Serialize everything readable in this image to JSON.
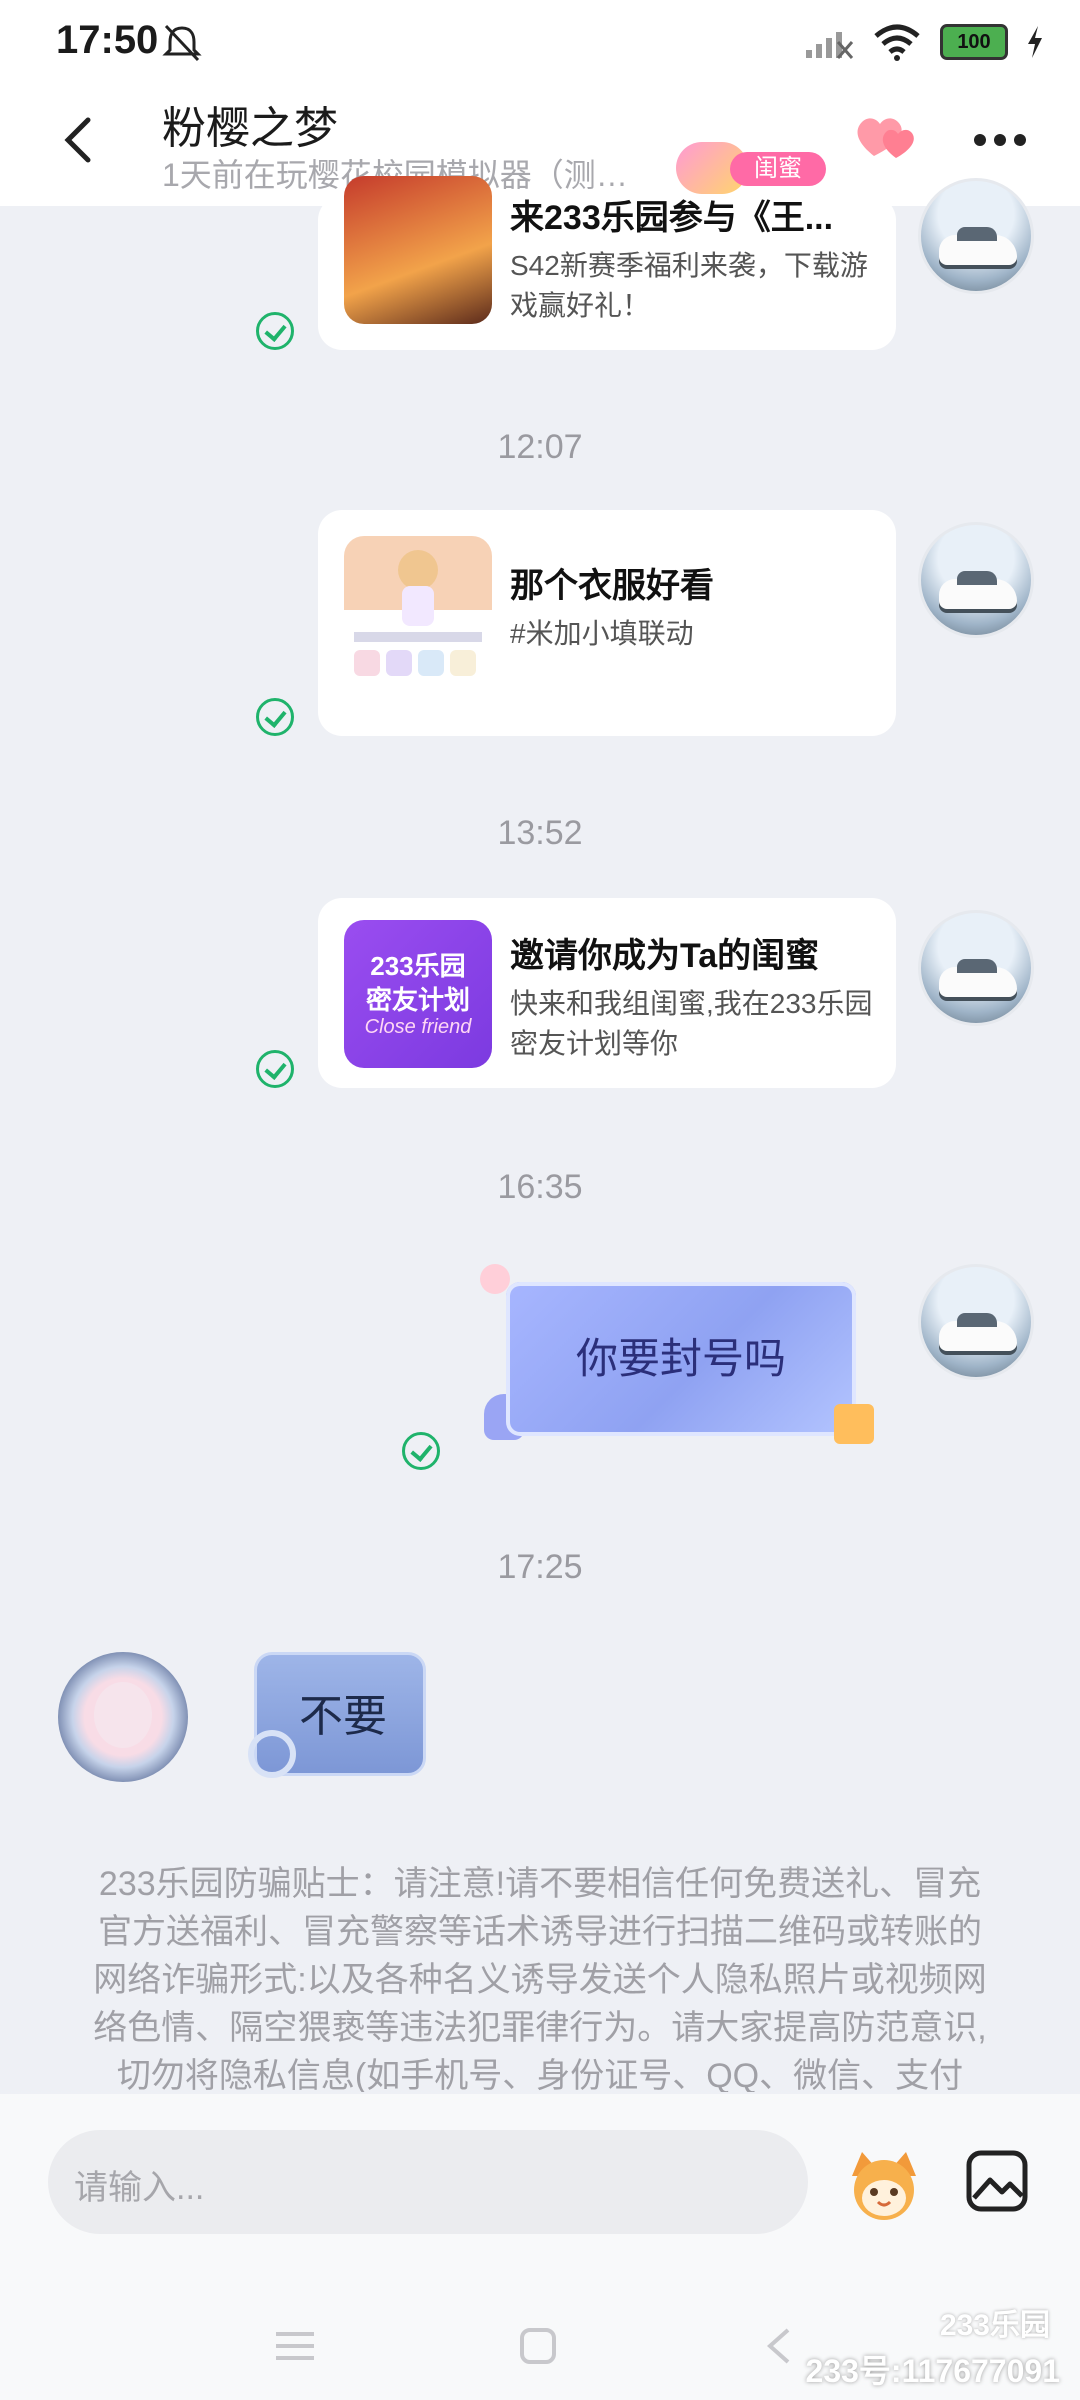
{
  "status_bar": {
    "time": "17:50",
    "battery": "100"
  },
  "header": {
    "title": "粉樱之梦",
    "subtitle": "1天前在玩樱花校园模拟器（测试...",
    "relation_tag": "闺蜜"
  },
  "messages": [
    {
      "kind": "card",
      "title": "来233乐园参与《王...",
      "desc": "S42新赛季福利来袭，下载游戏赢好礼！"
    },
    {
      "kind": "time",
      "text": "12:07"
    },
    {
      "kind": "card",
      "title": "那个衣服好看",
      "desc": "#米加小填联动"
    },
    {
      "kind": "time",
      "text": "13:52"
    },
    {
      "kind": "card",
      "title": "邀请你成为Ta的闺蜜",
      "desc": "快来和我组闺蜜,我在233乐园密友计划等你",
      "thumb_text_1": "233乐园",
      "thumb_text_2": "密友计划",
      "thumb_text_3": "Close friend"
    },
    {
      "kind": "time",
      "text": "16:35"
    },
    {
      "kind": "sticker",
      "text": "你要封号吗"
    },
    {
      "kind": "time",
      "text": "17:25"
    },
    {
      "kind": "reply",
      "text": "不要"
    }
  ],
  "notice": "233乐园防骗贴士：请注意!请不要相信任何免费送礼、冒充官方送福利、冒充警察等话术诱导进行扫描二维码或转账的网络诈骗形式:以及各种名义诱导发送个人隐私照片或视频网络色情、隔空猥亵等违法犯罪律行为。请大家提高防范意识,切勿将隐私信息(如手机号、身份证号、QQ、微信、支付",
  "input": {
    "placeholder": "请输入..."
  },
  "watermark": {
    "logo": "233乐园",
    "id": "233号:117677091"
  },
  "colors": {
    "check_green": "#1fb36b",
    "tag_pink": "#ff6aa6",
    "sticker_blue": "#a7b6ff"
  },
  "icons": [
    "back-arrow-icon",
    "heart-icon",
    "more-icon",
    "check-icon",
    "emoji-icon",
    "image-icon"
  ]
}
